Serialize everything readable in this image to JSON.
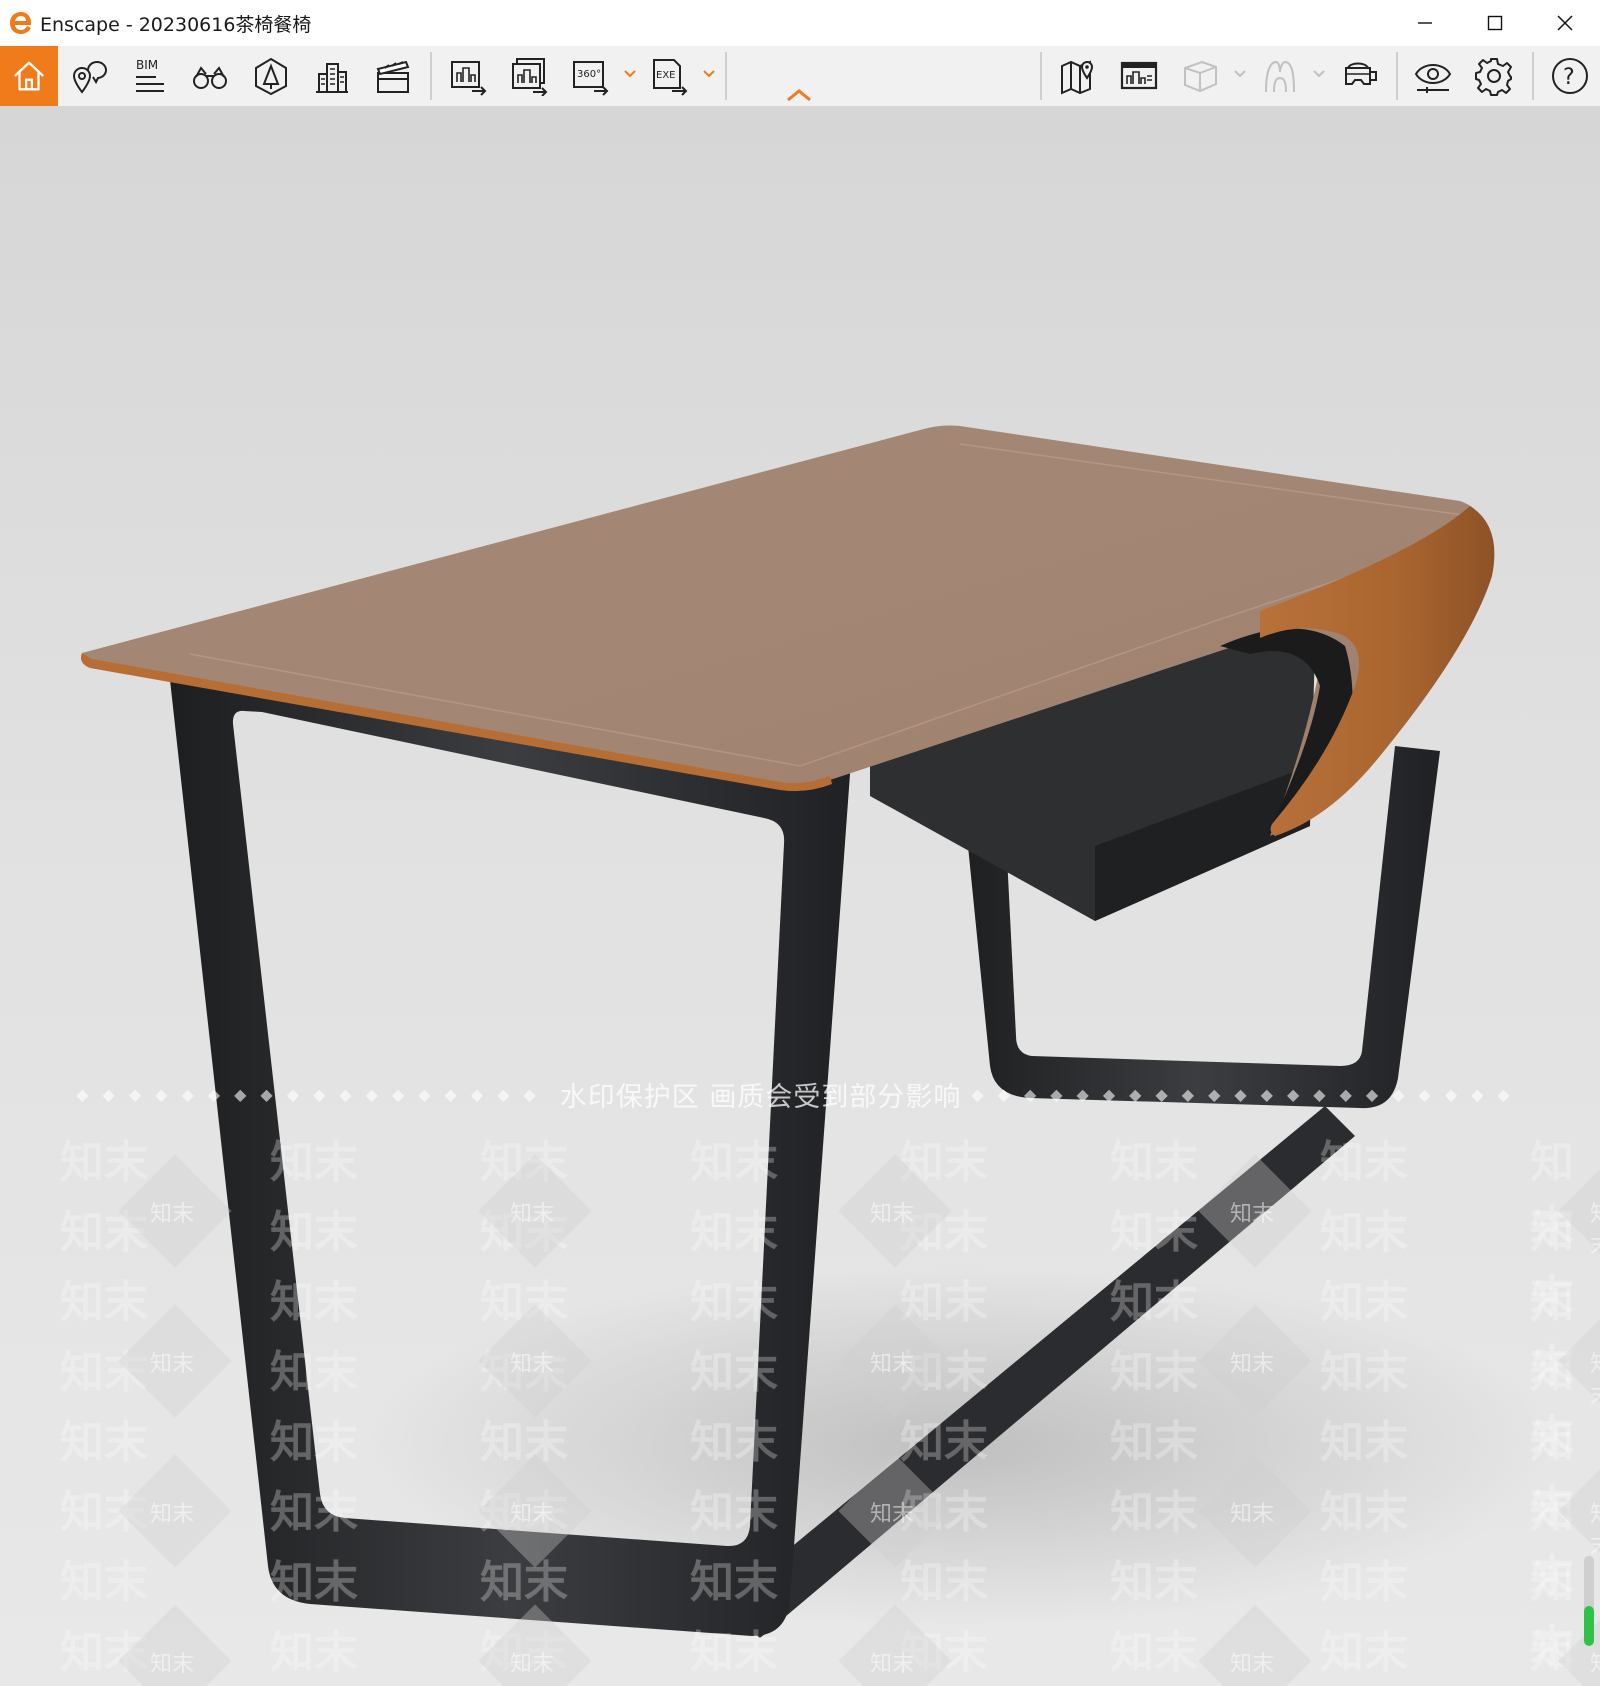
{
  "window": {
    "title": "Enscape - 20230616茶椅餐椅",
    "controls": [
      "minimize-icon",
      "maximize-icon",
      "close-icon"
    ]
  },
  "toolbar": {
    "accent_color": "#f07b1b",
    "left_group": [
      {
        "name": "home",
        "icon": "home-icon",
        "active": true
      },
      {
        "name": "views",
        "icon": "location-marker-icon"
      },
      {
        "name": "bim",
        "icon": "bim-icon",
        "label": "BIM"
      },
      {
        "name": "walk-mode",
        "icon": "binoculars-icon"
      },
      {
        "name": "asset-library",
        "icon": "asset-library-icon"
      },
      {
        "name": "city",
        "icon": "buildings-icon"
      },
      {
        "name": "video-editor",
        "icon": "clapperboard-icon"
      }
    ],
    "export_group": [
      {
        "name": "export-image",
        "icon": "export-image-icon"
      },
      {
        "name": "batch-export",
        "icon": "batch-export-icon"
      },
      {
        "name": "export-panorama",
        "icon": "export-panorama-icon",
        "label": "360°"
      },
      {
        "name": "export-exe",
        "icon": "export-exe-icon",
        "label": "EXE"
      }
    ],
    "right_group": [
      {
        "name": "minimap",
        "icon": "map-icon"
      },
      {
        "name": "info-panel",
        "icon": "info-panel-icon"
      },
      {
        "name": "section-box",
        "icon": "cube-icon",
        "disabled": true
      },
      {
        "name": "sun-study",
        "icon": "figure-icon",
        "disabled": true
      },
      {
        "name": "vr",
        "icon": "vr-headset-icon"
      },
      {
        "name": "visual-settings",
        "icon": "eye-icon"
      },
      {
        "name": "general-settings",
        "icon": "gear-icon"
      },
      {
        "name": "help",
        "icon": "help-icon",
        "label": "?"
      }
    ]
  },
  "viewport": {
    "watermark_text": "水印保护区   画质会受到部分影响",
    "watermark_brand": "知末",
    "slider_level": 0.45,
    "slider_color": "#2fc247"
  }
}
